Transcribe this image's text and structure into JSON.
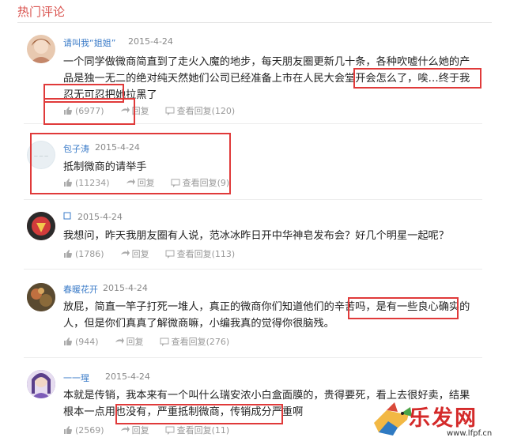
{
  "section": {
    "title": "热门评论"
  },
  "comments": [
    {
      "user": "请叫我“姐姐”",
      "date": "2015-4-24",
      "text": "一个同学做微商简直到了走火入魔的地步，每天朋友圈更新几十条，各种吹嘘什么她的产品是独一无二的绝对纯天然她们公司已经准备上市在人民大会堂开会怎么了，唉…终于我忍无可忍把她拉黑了",
      "likes": "(6977)",
      "reply": "回复",
      "view": "查看回复(120)",
      "avatar_color": "#e8c9b0"
    },
    {
      "user": "包子涛",
      "date": "2015-4-24",
      "text": "抵制微商的请举手",
      "likes": "(11234)",
      "reply": "回复",
      "view": "查看回复(9)",
      "avatar_color": "#dfe8ee"
    },
    {
      "user": "",
      "date": "2015-4-24",
      "text": "我想问，昨天我朋友圈有人说，范冰冰昨日开中华神皂发布会？好几个明星一起呢？",
      "likes": "(1786)",
      "reply": "回复",
      "view": "查看回复(113)",
      "avatar_color": "#c83a3a"
    },
    {
      "user": "春暖花开",
      "date": "2015-4-24",
      "text": "放屁，简直一竿子打死一堆人，真正的微商你们知道他们的辛苦吗，是有一些良心确实的人，但是你们真真了解微商嘛，小编我真的觉得你很脑残。",
      "likes": "(944)",
      "reply": "回复",
      "view": "查看回复(276)",
      "avatar_color": "#7a5a3a"
    },
    {
      "user": "一一瑆",
      "date": "2015-4-24",
      "text": "本就是传销，我本来有一个叫什么瑞安浓小白盒面膜的，贵得要死，看上去很好卖，结果根本一点用也没有，严重抵制微商，传销成分严重啊",
      "likes": "(2569)",
      "reply": "回复",
      "view": "查看回复(11)",
      "avatar_color": "#6e5aa8"
    }
  ],
  "watermark": {
    "logo": "乐发网",
    "url": "www.lfpf.cn"
  }
}
